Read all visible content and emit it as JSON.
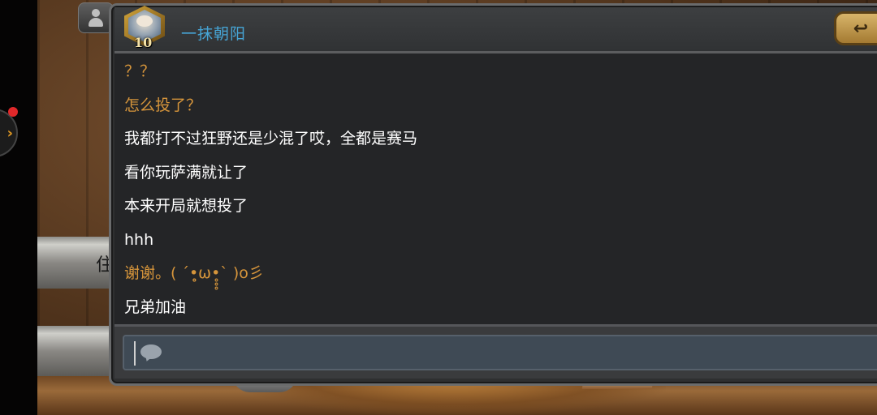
{
  "friend": {
    "name": "一抹朝阳",
    "level": "10"
  },
  "background": {
    "partial_text": "住"
  },
  "messages": [
    {
      "sender": "self",
      "text": "？？"
    },
    {
      "sender": "self",
      "text": "怎么投了？"
    },
    {
      "sender": "friend",
      "text": "我都打不过狂野还是少混了哎，全都是赛马"
    },
    {
      "sender": "friend",
      "text": "看你玩萨满就让了"
    },
    {
      "sender": "friend",
      "text": "本来开局就想投了"
    },
    {
      "sender": "friend",
      "text": "hhh"
    },
    {
      "sender": "self",
      "text": "谢谢。( ´•̥̥̥ω•̥̥̥` )o彡"
    },
    {
      "sender": "friend",
      "text": "兄弟加油"
    }
  ],
  "input": {
    "value": ""
  },
  "icons": {
    "close": "back-arrow-icon",
    "input": "speech-bubble-icon",
    "friends_tab": "chevron-right-icon",
    "player": "person-icon"
  },
  "colors": {
    "self_message": "#d6953b",
    "friend_message": "#ffffff",
    "friend_name": "#46a5d6",
    "notification": "#e0282a"
  }
}
